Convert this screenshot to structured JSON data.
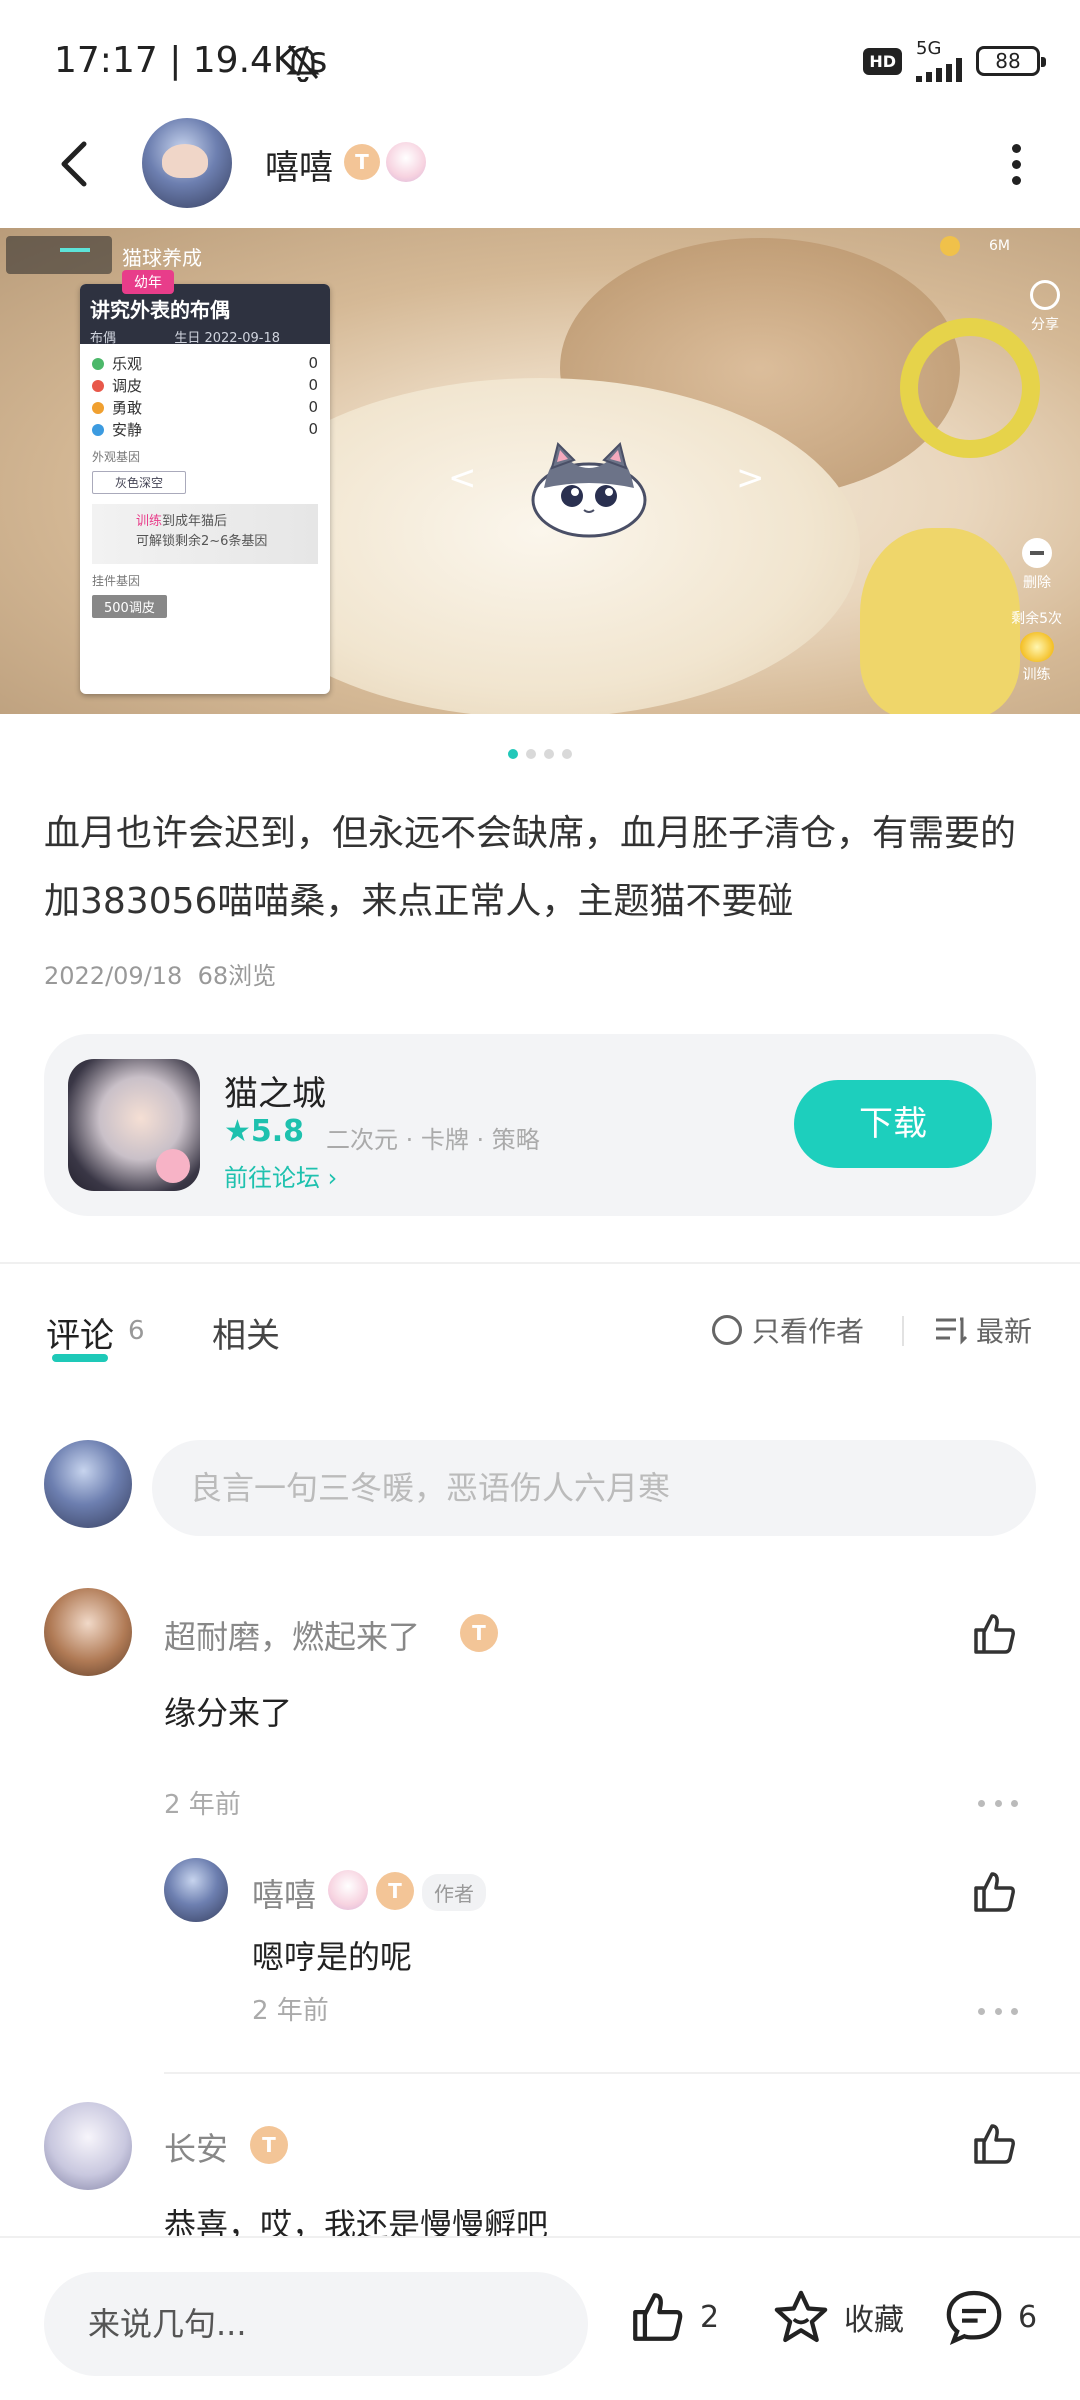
{
  "status_bar": {
    "time": "17:17",
    "speed": "19.4K/s",
    "hd": "HD",
    "network": "5G",
    "battery": "88"
  },
  "header": {
    "username": "嘻嘻",
    "badge_level": "T",
    "icons": [
      "back-arrow-icon",
      "more-vertical-icon"
    ]
  },
  "banner": {
    "game_title": "猫球养成",
    "share_label": "分享",
    "size_label": "6M",
    "delete_label": "删除",
    "remain_label": "剩余5次",
    "train_label": "训练",
    "nav_prev": "<",
    "nav_next": ">",
    "panel": {
      "stage_tag": "幼年",
      "name": "讲究外表的布偶",
      "breed": "布偶",
      "birthday": "生日 2022-09-18",
      "traits": [
        {
          "label": "乐观",
          "value": "0",
          "color": "#4cb86a"
        },
        {
          "label": "调皮",
          "value": "0",
          "color": "#e8584a"
        },
        {
          "label": "勇敢",
          "value": "0",
          "color": "#f0a030"
        },
        {
          "label": "安静",
          "value": "0",
          "color": "#3c9be0"
        }
      ],
      "appearance_section": "外观基因",
      "appearance_value": "灰色深空",
      "lock_line1_hl": "训练",
      "lock_line1": "到成年猫后",
      "lock_line2": "可解锁剩余2~6条基因",
      "pendant_section": "挂件基因",
      "pendant_value": "500调皮"
    },
    "page_dots": 4,
    "active_dot": 0
  },
  "post": {
    "text": "血月也许会迟到，但永远不会缺席，血月胚子清仓，有需要的加383056喵喵桑，来点正常人，主题猫不要碰",
    "date": "2022/09/18",
    "views": "68浏览"
  },
  "app_card": {
    "name": "猫之城",
    "rating": "5.8",
    "tags": "二次元 · 卡牌 · 策略",
    "forum_link": "前往论坛",
    "download_label": "下载"
  },
  "tabs": {
    "comments_label": "评论",
    "comments_count": "6",
    "related_label": "相关",
    "only_author_label": "只看作者",
    "sort_label": "最新"
  },
  "comment_input": {
    "placeholder": "良言一句三冬暖，恶语伤人六月寒"
  },
  "comments": [
    {
      "name": "超耐磨，燃起来了",
      "badge": "T",
      "text": "缘分来了",
      "time": "2 年前"
    },
    {
      "name": "嘻嘻",
      "badge": "T",
      "author_tag": "作者",
      "text": "嗯哼是的呢",
      "time": "2 年前",
      "is_reply": true
    },
    {
      "name": "长安",
      "badge": "T",
      "text": "恭喜，哎，我还是慢慢孵吧"
    }
  ],
  "bottom_bar": {
    "placeholder": "来说几句...",
    "likes": "2",
    "collect_label": "收藏",
    "comments": "6"
  }
}
